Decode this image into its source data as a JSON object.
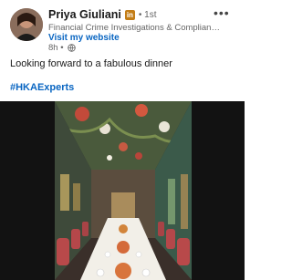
{
  "post": {
    "author_name": "Priya Giuliani",
    "badge": "in",
    "degree": "• 1st",
    "headline": "Financial Crime Investigations & Complian…",
    "website_link": "Visit my website",
    "time": "8h •",
    "text": "Looking forward to a fabulous dinner",
    "hashtag": "#HKAExperts"
  },
  "icons": {
    "more": "more-horizontal-icon",
    "visibility": "globe-icon"
  },
  "colors": {
    "link": "#0a66c2",
    "badge": "#c37d16",
    "media_background": "#121212"
  }
}
